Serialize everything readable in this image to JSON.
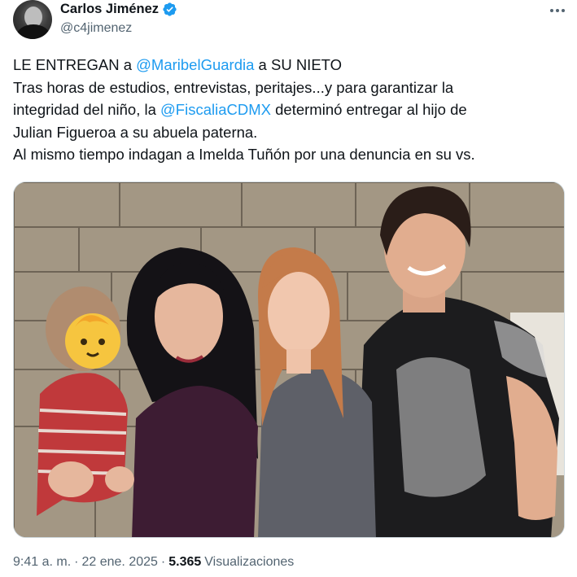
{
  "author": {
    "display_name": "Carlos Jiménez",
    "handle": "@c4jimenez",
    "verified": true,
    "avatar_icon": "user-avatar"
  },
  "tweet": {
    "line1": {
      "pre": "LE ENTREGAN a ",
      "mention": "@MaribelGuardia",
      "post": " a SU NIETO"
    },
    "line2": "Tras horas de estudios, entrevistas, peritajes...y para garantizar la",
    "line3": {
      "pre": "integridad del niño, la ",
      "mention": "@FiscaliaCDMX",
      "post": " determinó entregar al hijo de"
    },
    "line4": "Julian Figueroa a su abuela paterna.",
    "line5": "Al mismo tiempo indagan a Imelda Tuñón por una denuncia en su vs."
  },
  "meta": {
    "time": "9:41 a. m.",
    "separator": "·",
    "date": "22 ene. 2025",
    "views_count": "5.365",
    "views_label": "Visualizaciones"
  },
  "colors": {
    "accent": "#1d9bf0",
    "text": "#0f1419",
    "secondary": "#536471"
  }
}
